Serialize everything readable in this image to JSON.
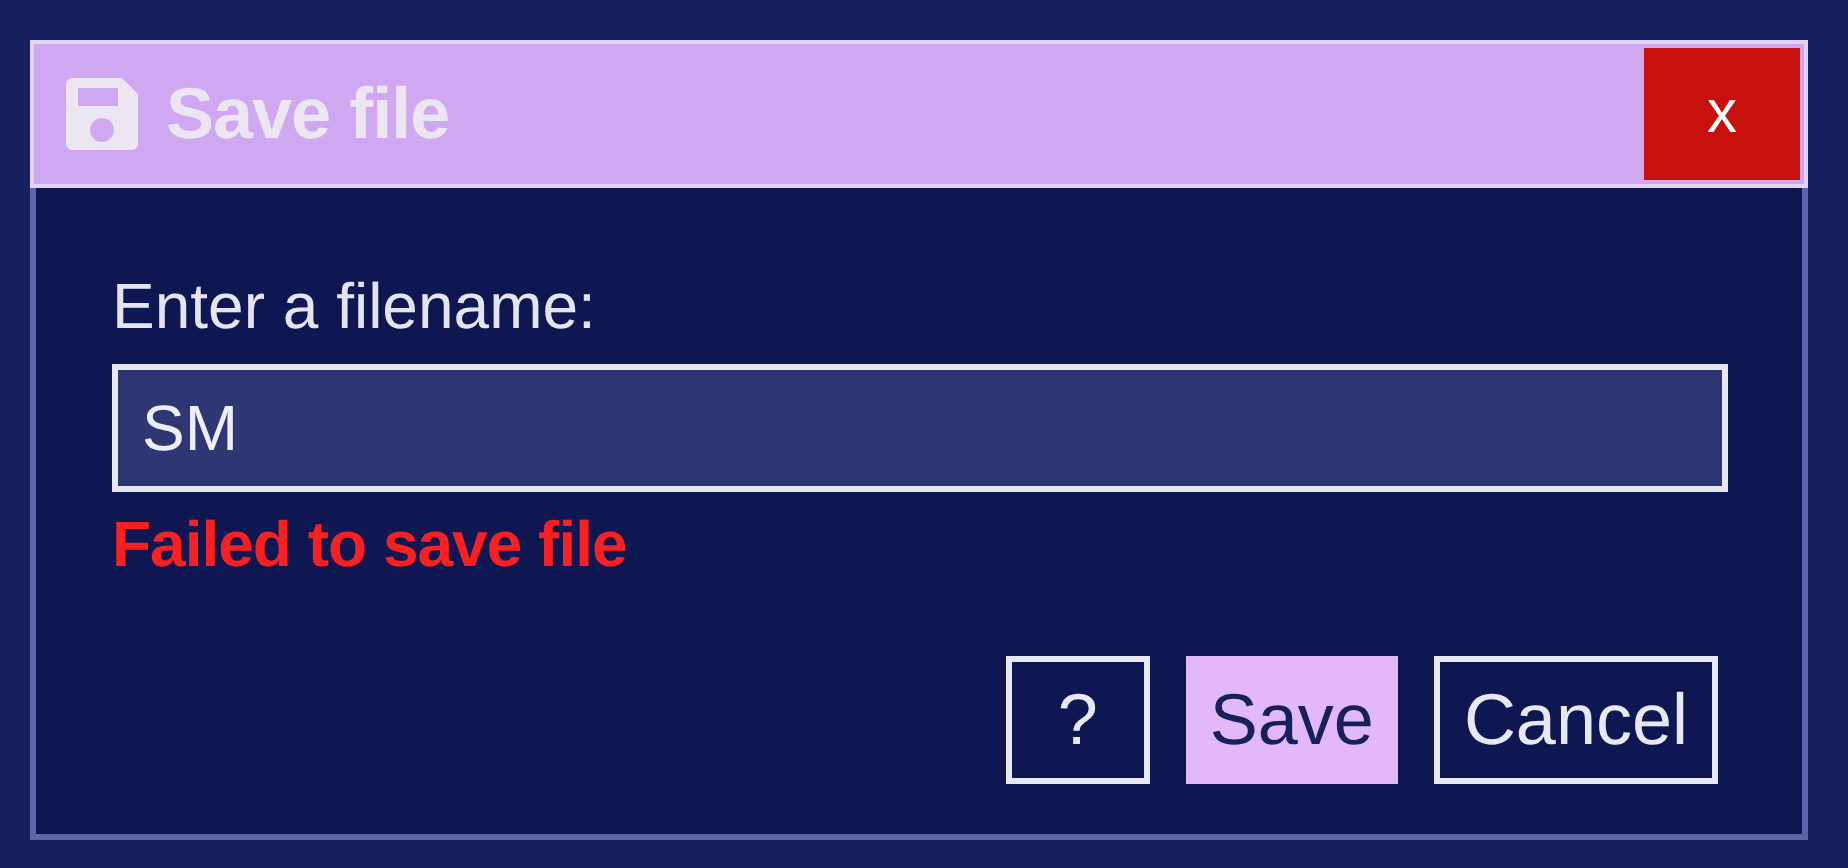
{
  "dialog": {
    "title": "Save file",
    "close_label": "x"
  },
  "prompt": "Enter a filename:",
  "filename_field": {
    "value": "SM"
  },
  "error": "Failed to save file",
  "buttons": [
    {
      "label": "?",
      "kind": "outline"
    },
    {
      "label": "Save",
      "kind": "filled"
    },
    {
      "label": "Cancel",
      "kind": "outline"
    }
  ]
}
